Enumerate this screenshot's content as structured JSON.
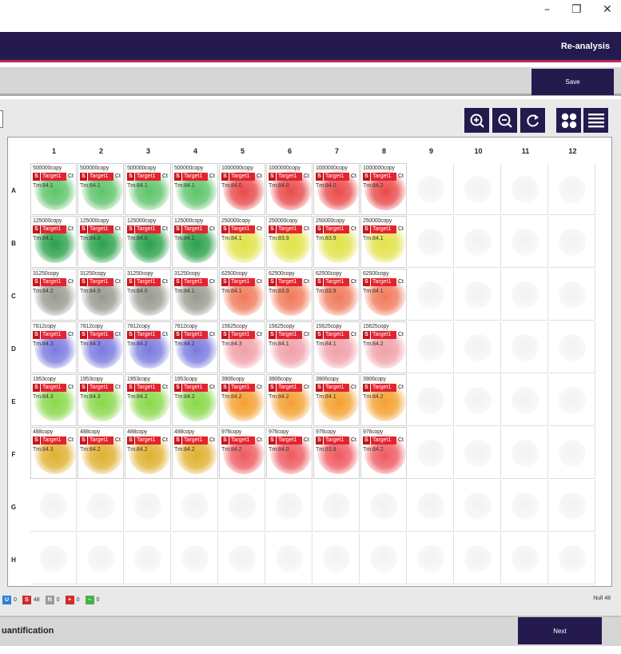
{
  "window": {
    "minimize": "–",
    "restore": "❐",
    "close": "✕"
  },
  "header": {
    "title": "Re-analysis"
  },
  "toolbar": {
    "save_label": "Save"
  },
  "view_buttons": [
    "zoom-in-icon",
    "zoom-out-icon",
    "reset-icon",
    "grid-view-icon",
    "list-view-icon"
  ],
  "plate": {
    "columns": [
      "1",
      "2",
      "3",
      "4",
      "5",
      "6",
      "7",
      "8",
      "9",
      "10",
      "11",
      "12"
    ],
    "rows": [
      "A",
      "B",
      "C",
      "D",
      "E",
      "F",
      "G",
      "H"
    ],
    "target_label": "Target1",
    "ct_label": "Ct",
    "s_label": "S",
    "wells": [
      {
        "row": 0,
        "col": 0,
        "conc": "500000copy",
        "tm": "Tm:84.1",
        "color": "#5ec46a"
      },
      {
        "row": 0,
        "col": 1,
        "conc": "500000copy",
        "tm": "Tm:84.1",
        "color": "#5ec46a"
      },
      {
        "row": 0,
        "col": 2,
        "conc": "500000copy",
        "tm": "Tm:84.1",
        "color": "#5ec46a"
      },
      {
        "row": 0,
        "col": 3,
        "conc": "500000copy",
        "tm": "Tm:84.1",
        "color": "#5ec46a"
      },
      {
        "row": 0,
        "col": 4,
        "conc": "1000000copy",
        "tm": "Tm:84.0",
        "color": "#e94a4a"
      },
      {
        "row": 0,
        "col": 5,
        "conc": "1000000copy",
        "tm": "Tm:84.0",
        "color": "#e94a4a"
      },
      {
        "row": 0,
        "col": 6,
        "conc": "1000000copy",
        "tm": "Tm:84.0",
        "color": "#e94a4a"
      },
      {
        "row": 0,
        "col": 7,
        "conc": "1000000copy",
        "tm": "Tm:84.2",
        "color": "#e94a4a"
      },
      {
        "row": 1,
        "col": 0,
        "conc": "125000copy",
        "tm": "Tm:84.1",
        "color": "#2aa14a"
      },
      {
        "row": 1,
        "col": 1,
        "conc": "125000copy",
        "tm": "Tm:84.0",
        "color": "#2aa14a"
      },
      {
        "row": 1,
        "col": 2,
        "conc": "125000copy",
        "tm": "Tm:84.0",
        "color": "#2aa14a"
      },
      {
        "row": 1,
        "col": 3,
        "conc": "125000copy",
        "tm": "Tm:84.1",
        "color": "#2aa14a"
      },
      {
        "row": 1,
        "col": 4,
        "conc": "250000copy",
        "tm": "Tm:84.1",
        "color": "#e2e24a"
      },
      {
        "row": 1,
        "col": 5,
        "conc": "250000copy",
        "tm": "Tm:83.9",
        "color": "#e2e24a"
      },
      {
        "row": 1,
        "col": 6,
        "conc": "250000copy",
        "tm": "Tm:83.9",
        "color": "#e2e24a"
      },
      {
        "row": 1,
        "col": 7,
        "conc": "250000copy",
        "tm": "Tm:84.1",
        "color": "#e2e24a"
      },
      {
        "row": 2,
        "col": 0,
        "conc": "31250copy",
        "tm": "Tm:84.2",
        "color": "#9a9a90"
      },
      {
        "row": 2,
        "col": 1,
        "conc": "31250copy",
        "tm": "Tm:84.0",
        "color": "#9a9a90"
      },
      {
        "row": 2,
        "col": 2,
        "conc": "31250copy",
        "tm": "Tm:84.0",
        "color": "#9a9a90"
      },
      {
        "row": 2,
        "col": 3,
        "conc": "31250copy",
        "tm": "Tm:84.1",
        "color": "#9a9a90"
      },
      {
        "row": 2,
        "col": 4,
        "conc": "62500copy",
        "tm": "Tm:84.1",
        "color": "#f07a5a"
      },
      {
        "row": 2,
        "col": 5,
        "conc": "62500copy",
        "tm": "Tm:83.9",
        "color": "#f07a5a"
      },
      {
        "row": 2,
        "col": 6,
        "conc": "62500copy",
        "tm": "Tm:83.9",
        "color": "#f07a5a"
      },
      {
        "row": 2,
        "col": 7,
        "conc": "62500copy",
        "tm": "Tm:84.1",
        "color": "#f07a5a"
      },
      {
        "row": 3,
        "col": 0,
        "conc": "7812copy",
        "tm": "Tm:84.3",
        "color": "#7a7ae0"
      },
      {
        "row": 3,
        "col": 1,
        "conc": "7812copy",
        "tm": "Tm:84.3",
        "color": "#7a7ae0"
      },
      {
        "row": 3,
        "col": 2,
        "conc": "7812copy",
        "tm": "Tm:84.2",
        "color": "#7a7ae0"
      },
      {
        "row": 3,
        "col": 3,
        "conc": "7812copy",
        "tm": "Tm:84.2",
        "color": "#7a7ae0"
      },
      {
        "row": 3,
        "col": 4,
        "conc": "15625copy",
        "tm": "Tm:84.3",
        "color": "#f0a0a8"
      },
      {
        "row": 3,
        "col": 5,
        "conc": "15625copy",
        "tm": "Tm:84.1",
        "color": "#f0a0a8"
      },
      {
        "row": 3,
        "col": 6,
        "conc": "15625copy",
        "tm": "Tm:84.1",
        "color": "#f0a0a8"
      },
      {
        "row": 3,
        "col": 7,
        "conc": "15625copy",
        "tm": "Tm:84.2",
        "color": "#f0a0a8"
      },
      {
        "row": 4,
        "col": 0,
        "conc": "1953copy",
        "tm": "Tm:84.3",
        "color": "#8ad84a"
      },
      {
        "row": 4,
        "col": 1,
        "conc": "1953copy",
        "tm": "Tm:84.3",
        "color": "#8ad84a"
      },
      {
        "row": 4,
        "col": 2,
        "conc": "1953copy",
        "tm": "Tm:84.2",
        "color": "#8ad84a"
      },
      {
        "row": 4,
        "col": 3,
        "conc": "1953copy",
        "tm": "Tm:84.2",
        "color": "#8ad84a"
      },
      {
        "row": 4,
        "col": 4,
        "conc": "3906copy",
        "tm": "Tm:84.2",
        "color": "#f5a030"
      },
      {
        "row": 4,
        "col": 5,
        "conc": "3906copy",
        "tm": "Tm:84.2",
        "color": "#f5a030"
      },
      {
        "row": 4,
        "col": 6,
        "conc": "3906copy",
        "tm": "Tm:84.1",
        "color": "#f5a030"
      },
      {
        "row": 4,
        "col": 7,
        "conc": "3906copy",
        "tm": "Tm:84.2",
        "color": "#f5a030"
      },
      {
        "row": 5,
        "col": 0,
        "conc": "488copy",
        "tm": "Tm:84.3",
        "color": "#e0b030"
      },
      {
        "row": 5,
        "col": 1,
        "conc": "488copy",
        "tm": "Tm:84.2",
        "color": "#e0b030"
      },
      {
        "row": 5,
        "col": 2,
        "conc": "488copy",
        "tm": "Tm:84.2",
        "color": "#e0b030"
      },
      {
        "row": 5,
        "col": 3,
        "conc": "488copy",
        "tm": "Tm:84.2",
        "color": "#e0b030"
      },
      {
        "row": 5,
        "col": 4,
        "conc": "976copy",
        "tm": "Tm:84.2",
        "color": "#ee5a60"
      },
      {
        "row": 5,
        "col": 5,
        "conc": "976copy",
        "tm": "Tm:84.0",
        "color": "#ee5a60"
      },
      {
        "row": 5,
        "col": 6,
        "conc": "976copy",
        "tm": "Tm:83.9",
        "color": "#ee5a60"
      },
      {
        "row": 5,
        "col": 7,
        "conc": "976copy",
        "tm": "Tm:84.2",
        "color": "#ee5a60"
      }
    ]
  },
  "legend": {
    "items": [
      {
        "symbol": "U",
        "count": "0",
        "color": "#2f7fd8"
      },
      {
        "symbol": "S",
        "count": "48",
        "color": "#d22b2b"
      },
      {
        "symbol": "N",
        "count": "0",
        "color": "#9a9a9a"
      },
      {
        "symbol": "+",
        "count": "0",
        "color": "#d22b2b"
      },
      {
        "symbol": "–",
        "count": "0",
        "color": "#48b048"
      }
    ],
    "null_label": "Null 48"
  },
  "footer": {
    "label": "uantification",
    "next_label": "Next"
  }
}
